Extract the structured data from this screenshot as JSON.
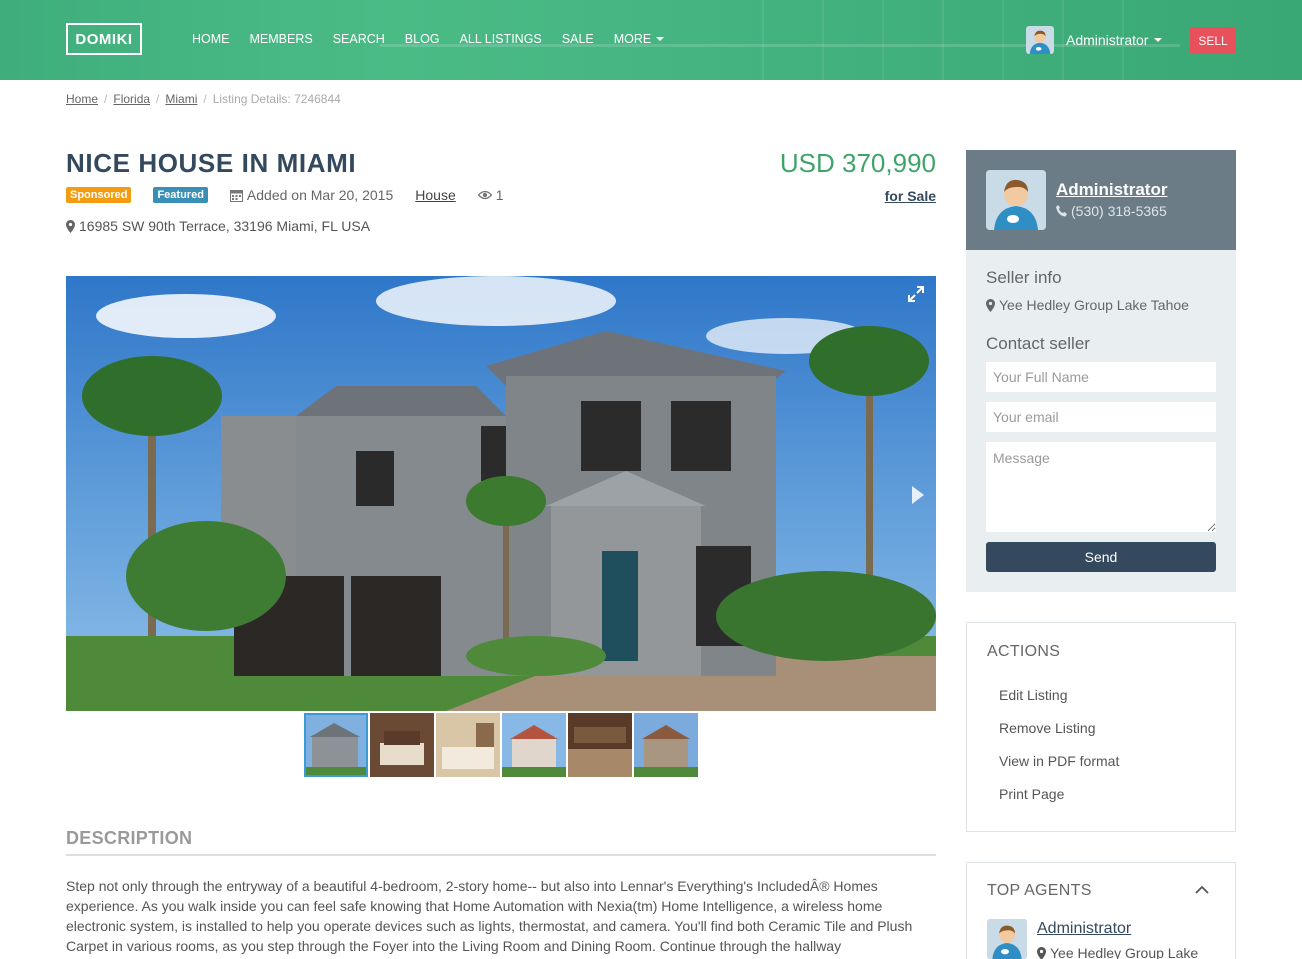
{
  "header": {
    "logo": "DOMIKI",
    "nav": [
      "HOME",
      "MEMBERS",
      "SEARCH",
      "BLOG",
      "ALL LISTINGS",
      "SALE",
      "MORE"
    ],
    "user_name": "Administrator",
    "sell_label": "SELL",
    "accent_color": "#4bbb86"
  },
  "breadcrumb": {
    "items": [
      "Home",
      "Florida",
      "Miami"
    ],
    "current": "Listing Details: 7246844"
  },
  "listing": {
    "title": "NICE HOUSE IN MIAMI",
    "price": "USD 370,990",
    "badge_sponsored": "Sponsored",
    "badge_featured": "Featured",
    "added": "Added on Mar 20, 2015",
    "category": "House",
    "views": "1",
    "status": "for Sale",
    "address": "16985 SW 90th Terrace, 33196 Miami, FL USA",
    "thumb_count": "6"
  },
  "description": {
    "heading": "DESCRIPTION",
    "text": "Step not only through the entryway of a beautiful 4-bedroom, 2-story home-- but also into Lennar's Everything's IncludedÂ® Homes experience. As you walk inside you can feel safe knowing that Home Automation with Nexia(tm) Home Intelligence, a wireless home electronic system, is installed to help you operate devices such as lights, thermostat, and camera. You'll find both Ceramic Tile and Plush Carpet in various rooms, as you step through the Foyer into the Living Room and Dining Room. Continue through the hallway"
  },
  "seller": {
    "name": "Administrator",
    "phone": "(530) 318-5365",
    "info_heading": "Seller info",
    "org": "Yee Hedley Group Lake Tahoe",
    "contact_heading": "Contact seller",
    "name_placeholder": "Your Full Name",
    "email_placeholder": "Your email",
    "message_placeholder": "Message",
    "send_label": "Send"
  },
  "actions": {
    "heading": "ACTIONS",
    "items": [
      "Edit Listing",
      "Remove Listing",
      "View in PDF format",
      "Print Page"
    ]
  },
  "top_agents": {
    "heading": "TOP AGENTS",
    "name": "Administrator",
    "org": "Yee Hedley Group Lake"
  }
}
